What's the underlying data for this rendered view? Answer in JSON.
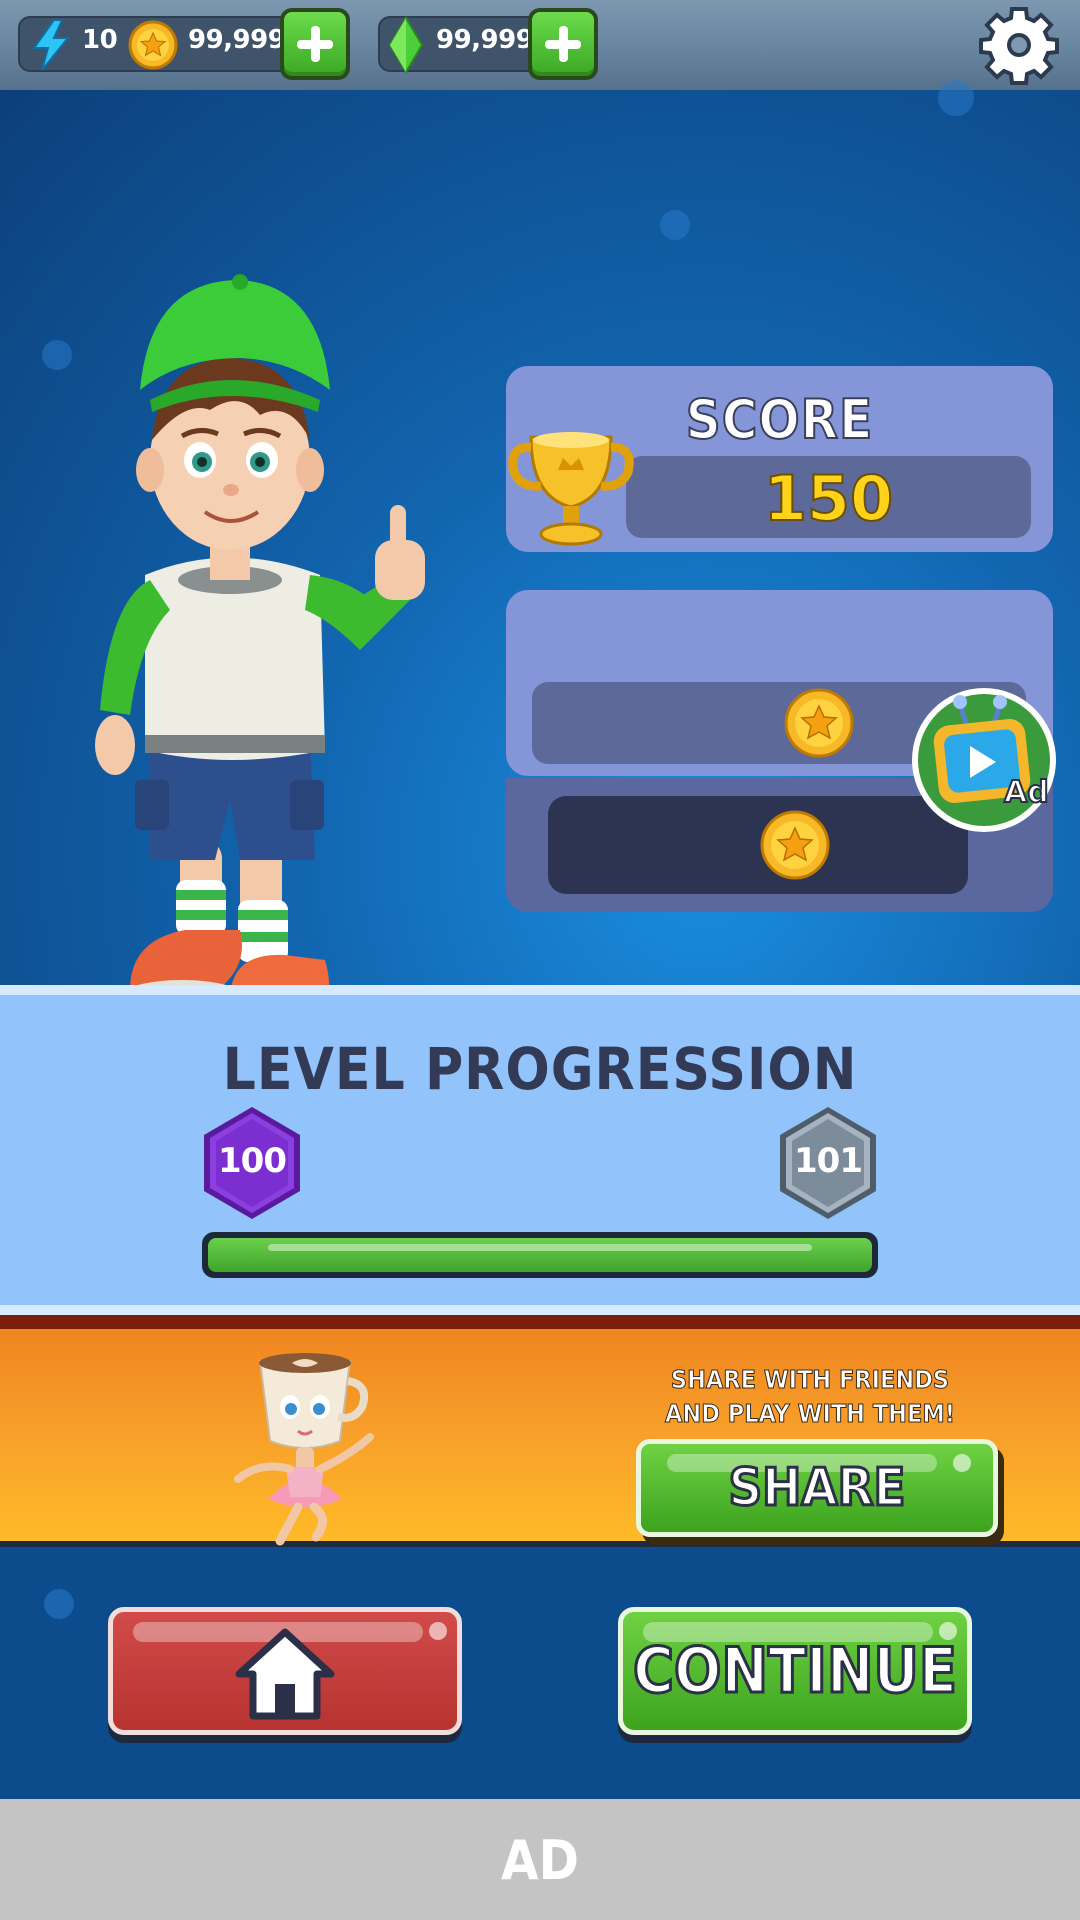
{
  "resources": {
    "energy": "10",
    "coins": "99,999",
    "gems": "99,999"
  },
  "icons": {
    "energy": "lightning-bolt-icon",
    "coin": "star-coin-icon",
    "gem": "green-gem-icon",
    "plus": "plus-icon",
    "settings": "gear-icon",
    "trophy": "trophy-icon",
    "ad": "video-ad-tv-icon",
    "home": "home-icon"
  },
  "score": {
    "title": "SCORE",
    "value": "150"
  },
  "rewards": {
    "ad_badge_label": "Ad"
  },
  "level": {
    "title": "LEVEL PROGRESSION",
    "current": "100",
    "next": "101",
    "progress": 1.0
  },
  "share": {
    "line1": "SHARE WITH FRIENDS",
    "line2": "AND PLAY WITH THEM!",
    "button_label": "SHARE"
  },
  "buttons": {
    "continue_label": "CONTINUE"
  },
  "ad_bar": {
    "label": "AD"
  },
  "colors": {
    "accent_green": "#3da31e",
    "home_red": "#b73330",
    "score_yellow": "#ffd21c",
    "level_current": "#7b2fd0",
    "level_next": "#7d8c9b"
  }
}
